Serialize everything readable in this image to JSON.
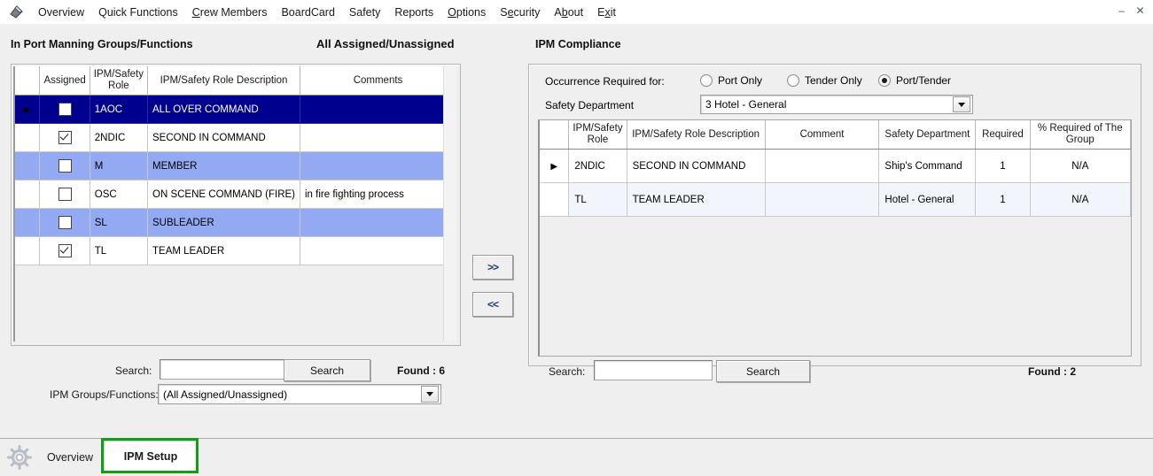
{
  "menu": {
    "app_icon": "app-logo-icon",
    "items": [
      {
        "label": "Overview",
        "accel": ""
      },
      {
        "label": "Quick Functions",
        "accel": ""
      },
      {
        "label": "Crew Members",
        "accel": "C"
      },
      {
        "label": "BoardCard",
        "accel": ""
      },
      {
        "label": "Safety",
        "accel": ""
      },
      {
        "label": "Reports",
        "accel": ""
      },
      {
        "label": "Options",
        "accel": "O"
      },
      {
        "label": "Security",
        "accel": "e"
      },
      {
        "label": "About",
        "accel": "b"
      },
      {
        "label": "Exit",
        "accel": "x"
      }
    ],
    "window_controls": [
      {
        "name": "minimize-button",
        "glyph": "–"
      },
      {
        "name": "close-button",
        "glyph": "✕"
      }
    ]
  },
  "left_panel": {
    "title": "In Port Manning Groups/Functions",
    "subtitle": "All Assigned/Unassigned",
    "grid": {
      "columns": [
        "Assigned",
        "IPM/Safety Role",
        "IPM/Safety Role Description",
        "Comments"
      ],
      "rows": [
        {
          "marker": "▶",
          "assigned": false,
          "role": "1AOC",
          "description": "ALL OVER COMMAND",
          "comments": "",
          "state": "selected"
        },
        {
          "marker": "",
          "assigned": true,
          "role": "2NDIC",
          "description": "SECOND IN COMMAND",
          "comments": "",
          "state": "normal"
        },
        {
          "marker": "",
          "assigned": false,
          "role": "M",
          "description": "MEMBER",
          "comments": "",
          "state": "alt"
        },
        {
          "marker": "",
          "assigned": false,
          "role": "OSC",
          "description": "ON SCENE COMMAND (FIRE)",
          "comments": "in fire fighting process",
          "state": "normal"
        },
        {
          "marker": "",
          "assigned": false,
          "role": "SL",
          "description": "SUBLEADER",
          "comments": "",
          "state": "alt"
        },
        {
          "marker": "",
          "assigned": true,
          "role": "TL",
          "description": "TEAM LEADER",
          "comments": "",
          "state": "normal"
        }
      ]
    },
    "search_label": "Search:",
    "search_value": "",
    "search_button": "Search",
    "found": "Found : 6",
    "filter_label": "IPM Groups/Functions:",
    "filter_value": "(All Assigned/Unassigned)"
  },
  "transfer": {
    "add_label": ">>",
    "remove_label": "<<"
  },
  "right_panel": {
    "title": "IPM Compliance",
    "occurrence_label": "Occurrence Required for:",
    "radios": [
      {
        "label": "Port Only",
        "selected": false
      },
      {
        "label": "Tender Only",
        "selected": false
      },
      {
        "label": "Port/Tender",
        "selected": true
      }
    ],
    "safety_department_label": "Safety Department",
    "safety_department_value": "3 Hotel - General",
    "grid": {
      "columns": [
        "IPM/Safety Role",
        "IPM/Safety Role Description",
        "Comment",
        "Safety Department",
        "Required",
        "% Required of The Group"
      ],
      "rows": [
        {
          "marker": "▶",
          "role": "2NDIC",
          "description": "SECOND IN COMMAND",
          "comment": "",
          "department": "Ship's Command",
          "required": "1",
          "percent": "N/A",
          "state": "normal"
        },
        {
          "marker": "",
          "role": "TL",
          "description": "TEAM LEADER",
          "comment": "",
          "department": "Hotel - General",
          "required": "1",
          "percent": "N/A",
          "state": "alt"
        }
      ]
    },
    "search_label": "Search:",
    "search_value": "",
    "search_button": "Search",
    "found": "Found : 2"
  },
  "tabbar": {
    "gear_icon": "gear-icon",
    "tabs": [
      {
        "label": "Overview",
        "active": false
      },
      {
        "label": "IPM Setup",
        "active": true
      }
    ],
    "highlight_color": "#11a011"
  }
}
